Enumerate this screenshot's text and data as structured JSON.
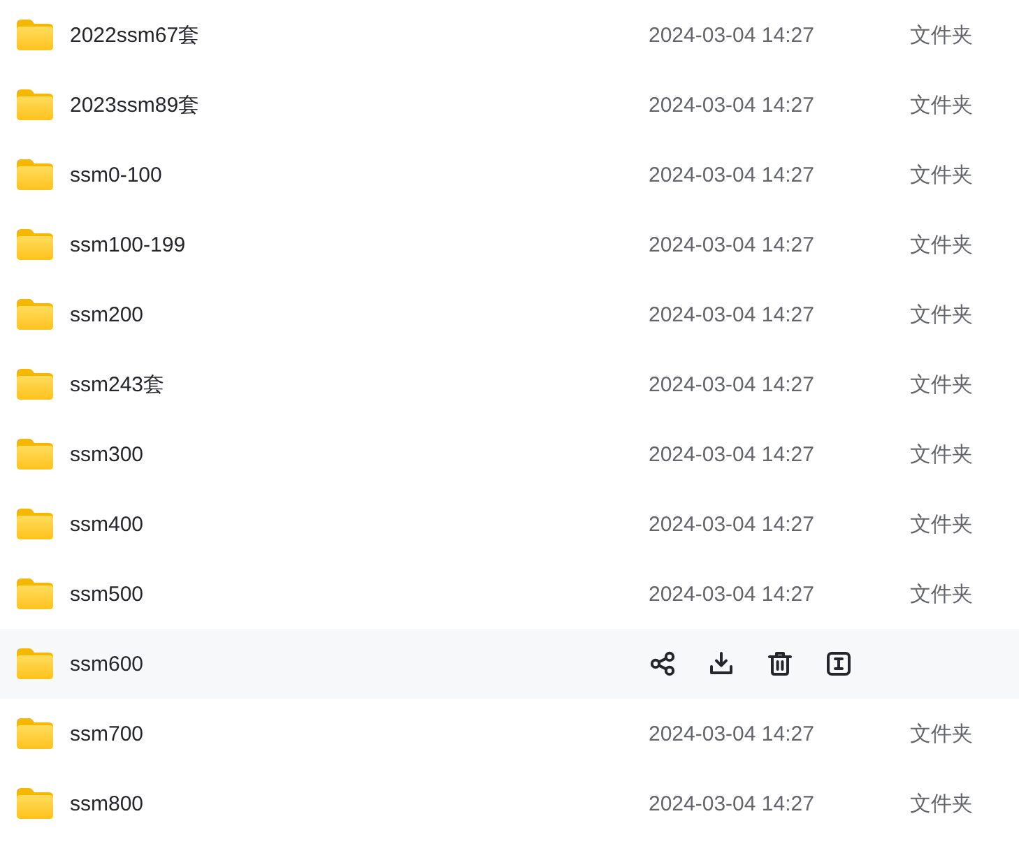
{
  "files": [
    {
      "name": "2022ssm67套",
      "modified": "2024-03-04 14:27",
      "type": "文件夹",
      "hovered": false
    },
    {
      "name": "2023ssm89套",
      "modified": "2024-03-04 14:27",
      "type": "文件夹",
      "hovered": false
    },
    {
      "name": "ssm0-100",
      "modified": "2024-03-04 14:27",
      "type": "文件夹",
      "hovered": false
    },
    {
      "name": "ssm100-199",
      "modified": "2024-03-04 14:27",
      "type": "文件夹",
      "hovered": false
    },
    {
      "name": "ssm200",
      "modified": "2024-03-04 14:27",
      "type": "文件夹",
      "hovered": false
    },
    {
      "name": "ssm243套",
      "modified": "2024-03-04 14:27",
      "type": "文件夹",
      "hovered": false
    },
    {
      "name": "ssm300",
      "modified": "2024-03-04 14:27",
      "type": "文件夹",
      "hovered": false
    },
    {
      "name": "ssm400",
      "modified": "2024-03-04 14:27",
      "type": "文件夹",
      "hovered": false
    },
    {
      "name": "ssm500",
      "modified": "2024-03-04 14:27",
      "type": "文件夹",
      "hovered": false
    },
    {
      "name": "ssm600",
      "hovered": true
    },
    {
      "name": "ssm700",
      "modified": "2024-03-04 14:27",
      "type": "文件夹",
      "hovered": false
    },
    {
      "name": "ssm800",
      "modified": "2024-03-04 14:27",
      "type": "文件夹",
      "hovered": false
    }
  ]
}
